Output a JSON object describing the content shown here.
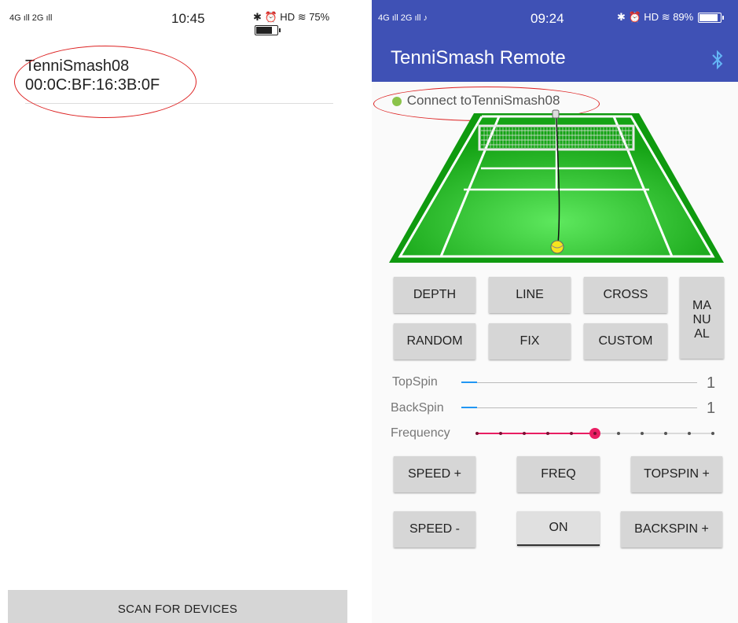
{
  "left": {
    "status": {
      "signal": "4G ıll 2G ıll",
      "time": "10:45",
      "icons": "✱ ⏰ HD ≋ 75%",
      "battery_level": 0.75
    },
    "device": {
      "name": "TenniSmash08",
      "mac": "00:0C:BF:16:3B:0F"
    },
    "scan_label": "SCAN FOR DEVICES"
  },
  "right": {
    "status": {
      "signal": "4G ıll 2G ıll ♪",
      "time": "09:24",
      "icons": "✱ ⏰ HD ≋ 89%",
      "battery_level": 0.89
    },
    "app_title": "TenniSmash Remote",
    "connect_text": "Connect toTenniSmash08",
    "buttons": {
      "depth": "DEPTH",
      "line": "LINE",
      "cross": "CROSS",
      "manual_1": "MA",
      "manual_2": "NU",
      "manual_3": "AL",
      "random": "RANDOM",
      "fix": "FIX",
      "custom": "CUSTOM",
      "speed_plus": "SPEED +",
      "freq": "FREQ",
      "topspin_plus": "TOPSPIN +",
      "speed_minus": "SPEED -",
      "on": "ON",
      "backspin_plus": "BACKSPIN +"
    },
    "sliders": {
      "topspin": {
        "label": "TopSpin",
        "value": "1"
      },
      "backspin": {
        "label": "BackSpin",
        "value": "1"
      },
      "frequency": {
        "label": "Frequency",
        "steps": 11,
        "selected": 5
      }
    },
    "colors": {
      "primary": "#3f51b5",
      "accent": "#e91e63",
      "slider_blue": "#2196f3",
      "court_green": "#1aa31a",
      "connected_dot": "#8bc34a"
    }
  }
}
